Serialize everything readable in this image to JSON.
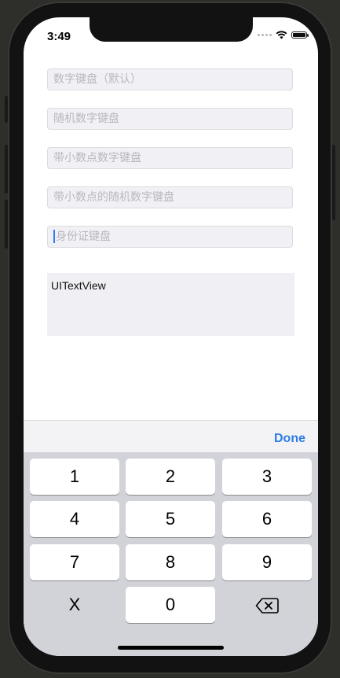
{
  "status": {
    "time": "3:49"
  },
  "fields": [
    {
      "placeholder": "数字键盘（默认）"
    },
    {
      "placeholder": "随机数字键盘"
    },
    {
      "placeholder": "带小数点数字键盘"
    },
    {
      "placeholder": "带小数点的随机数字键盘"
    },
    {
      "placeholder": "身份证键盘"
    }
  ],
  "textview": {
    "text": "UITextView"
  },
  "accessory": {
    "done_label": "Done"
  },
  "keyboard": {
    "keys": [
      "1",
      "2",
      "3",
      "4",
      "5",
      "6",
      "7",
      "8",
      "9",
      "X",
      "0"
    ],
    "delete_icon": "backspace-icon"
  },
  "colors": {
    "accent": "#2f7de1",
    "keyboard_bg": "#d1d3d9",
    "field_bg": "#f1f1f5"
  }
}
